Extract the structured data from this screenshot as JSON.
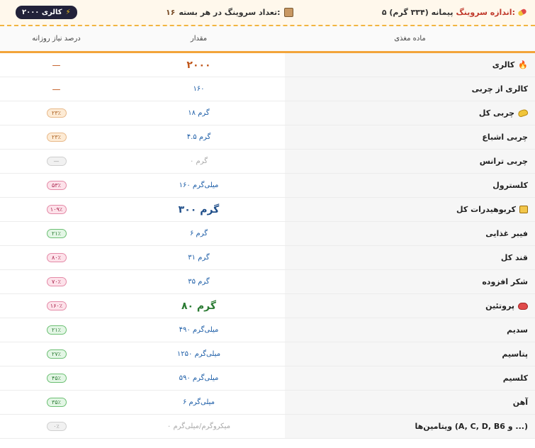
{
  "header": {
    "serving_label": "اندازه سروینگ:",
    "serving_value": "۵ پیمانه (۳۳۴ گرم)",
    "count_label": "تعداد سروینگ در هر بسته:",
    "count_value": "۱۶",
    "calorie_pill": "۲۰۰۰ کالری"
  },
  "columns": {
    "nutrient": "ماده مغذی",
    "amount": "مقدار",
    "daily": "درصد نیاز روزانه"
  },
  "rows": [
    {
      "name": "کالری",
      "amount": "۲۰۰۰",
      "pct": "—"
    },
    {
      "name": "کالری از چربی",
      "amount": "۱۶۰",
      "pct": "—"
    },
    {
      "name": "چربی کل",
      "amount": "۱۸ گرم",
      "pct": "۲۳٪"
    },
    {
      "name": "چربی اشباع",
      "amount": "۴.۵ گرم",
      "pct": "۲۳٪"
    },
    {
      "name": "چربی ترانس",
      "amount": "۰ گرم",
      "pct": "—"
    },
    {
      "name": "کلسترول",
      "amount": "۱۶۰ میلی‌گرم",
      "pct": "۵۳٪"
    },
    {
      "name": "کربوهیدرات کل",
      "amount": "۳۰۰ گرم",
      "pct": "۱۰۹٪"
    },
    {
      "name": "فیبر غذایی",
      "amount": "۶ گرم",
      "pct": "۲۱٪"
    },
    {
      "name": "قند کل",
      "amount": "۳۱ گرم",
      "pct": "۸۰٪"
    },
    {
      "name": "شکر افزوده",
      "amount": "۳۵ گرم",
      "pct": "۷۰٪"
    },
    {
      "name": "پروتئین",
      "amount": "۸۰ گرم",
      "pct": "۱۶۰٪"
    },
    {
      "name": "سدیم",
      "amount": "۴۹۰ میلی‌گرم",
      "pct": "۲۱٪"
    },
    {
      "name": "پتاسیم",
      "amount": "۱۲۵۰ میلی‌گرم",
      "pct": "۲۷٪"
    },
    {
      "name": "کلسیم",
      "amount": "۵۹۰ میلی‌گرم",
      "pct": "۴۵٪"
    },
    {
      "name": "آهن",
      "amount": "۶ میلی‌گرم",
      "pct": "۳۵٪"
    },
    {
      "name": "ویتامین‌ها (A, C, D, B6 و ...)",
      "amount": "۰ میکروگرم/میلی‌گرم",
      "pct": "۰٪"
    }
  ],
  "colors": {
    "accent": "#f2a43a",
    "amount_blue": "#1f5fa8",
    "calorie_orange": "#c0561a",
    "protein_green": "#2a7a32"
  },
  "icons": {
    "serving": "pill-icon",
    "count": "box-icon",
    "pill": "lightning-icon",
    "calorie": "fire-icon",
    "fat": "butter-icon",
    "carb": "bread-icon",
    "protein": "meat-icon"
  }
}
